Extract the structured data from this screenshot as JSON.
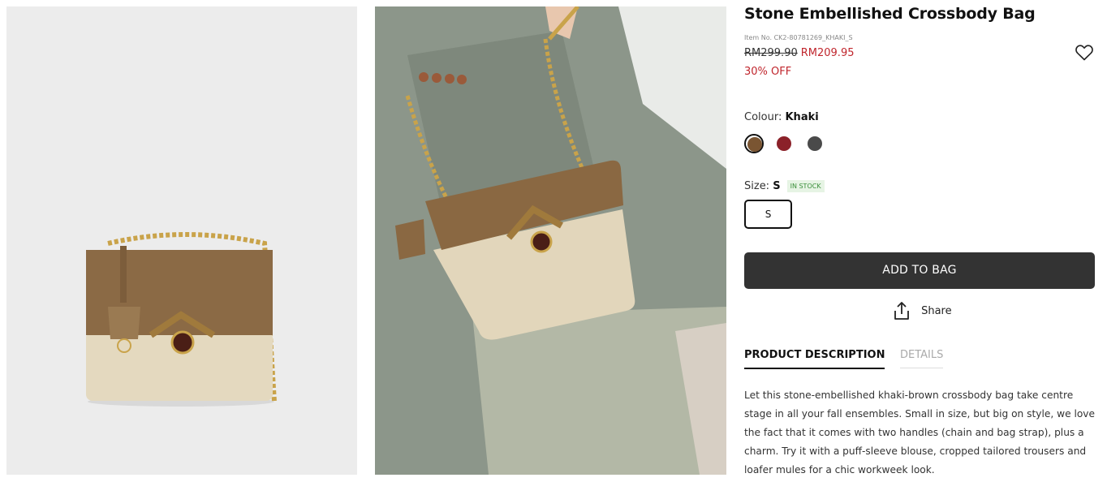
{
  "product": {
    "title": "Stone Embellished Crossbody Bag",
    "item_no": "Item No. CK2-80781269_KHAKI_S",
    "price_original": "RM299.90",
    "price_sale": "RM209.95",
    "discount": "30% OFF"
  },
  "colour": {
    "label": "Colour:",
    "selected": "Khaki",
    "swatches": [
      {
        "name": "Khaki",
        "color": "#7a5532"
      },
      {
        "name": "Burgundy",
        "color": "#8b2129"
      },
      {
        "name": "Dark Grey",
        "color": "#4a4a4a"
      }
    ]
  },
  "size": {
    "label": "Size:",
    "selected": "S",
    "stock": "IN STOCK",
    "options": [
      "S"
    ]
  },
  "actions": {
    "add_to_bag": "ADD TO BAG",
    "share": "Share"
  },
  "tabs": [
    "PRODUCT DESCRIPTION",
    "DETAILS"
  ],
  "description": "Let this stone-embellished khaki-brown crossbody bag take centre stage in all your fall ensembles. Small in size, but big on style, we love the fact that it comes with two handles (chain and bag strap), plus a charm. Try it with a puff-sleeve blouse, cropped tailored trousers and loafer mules for a chic workweek look.",
  "icons": {
    "wishlist": "heart-icon",
    "share": "share-icon"
  }
}
